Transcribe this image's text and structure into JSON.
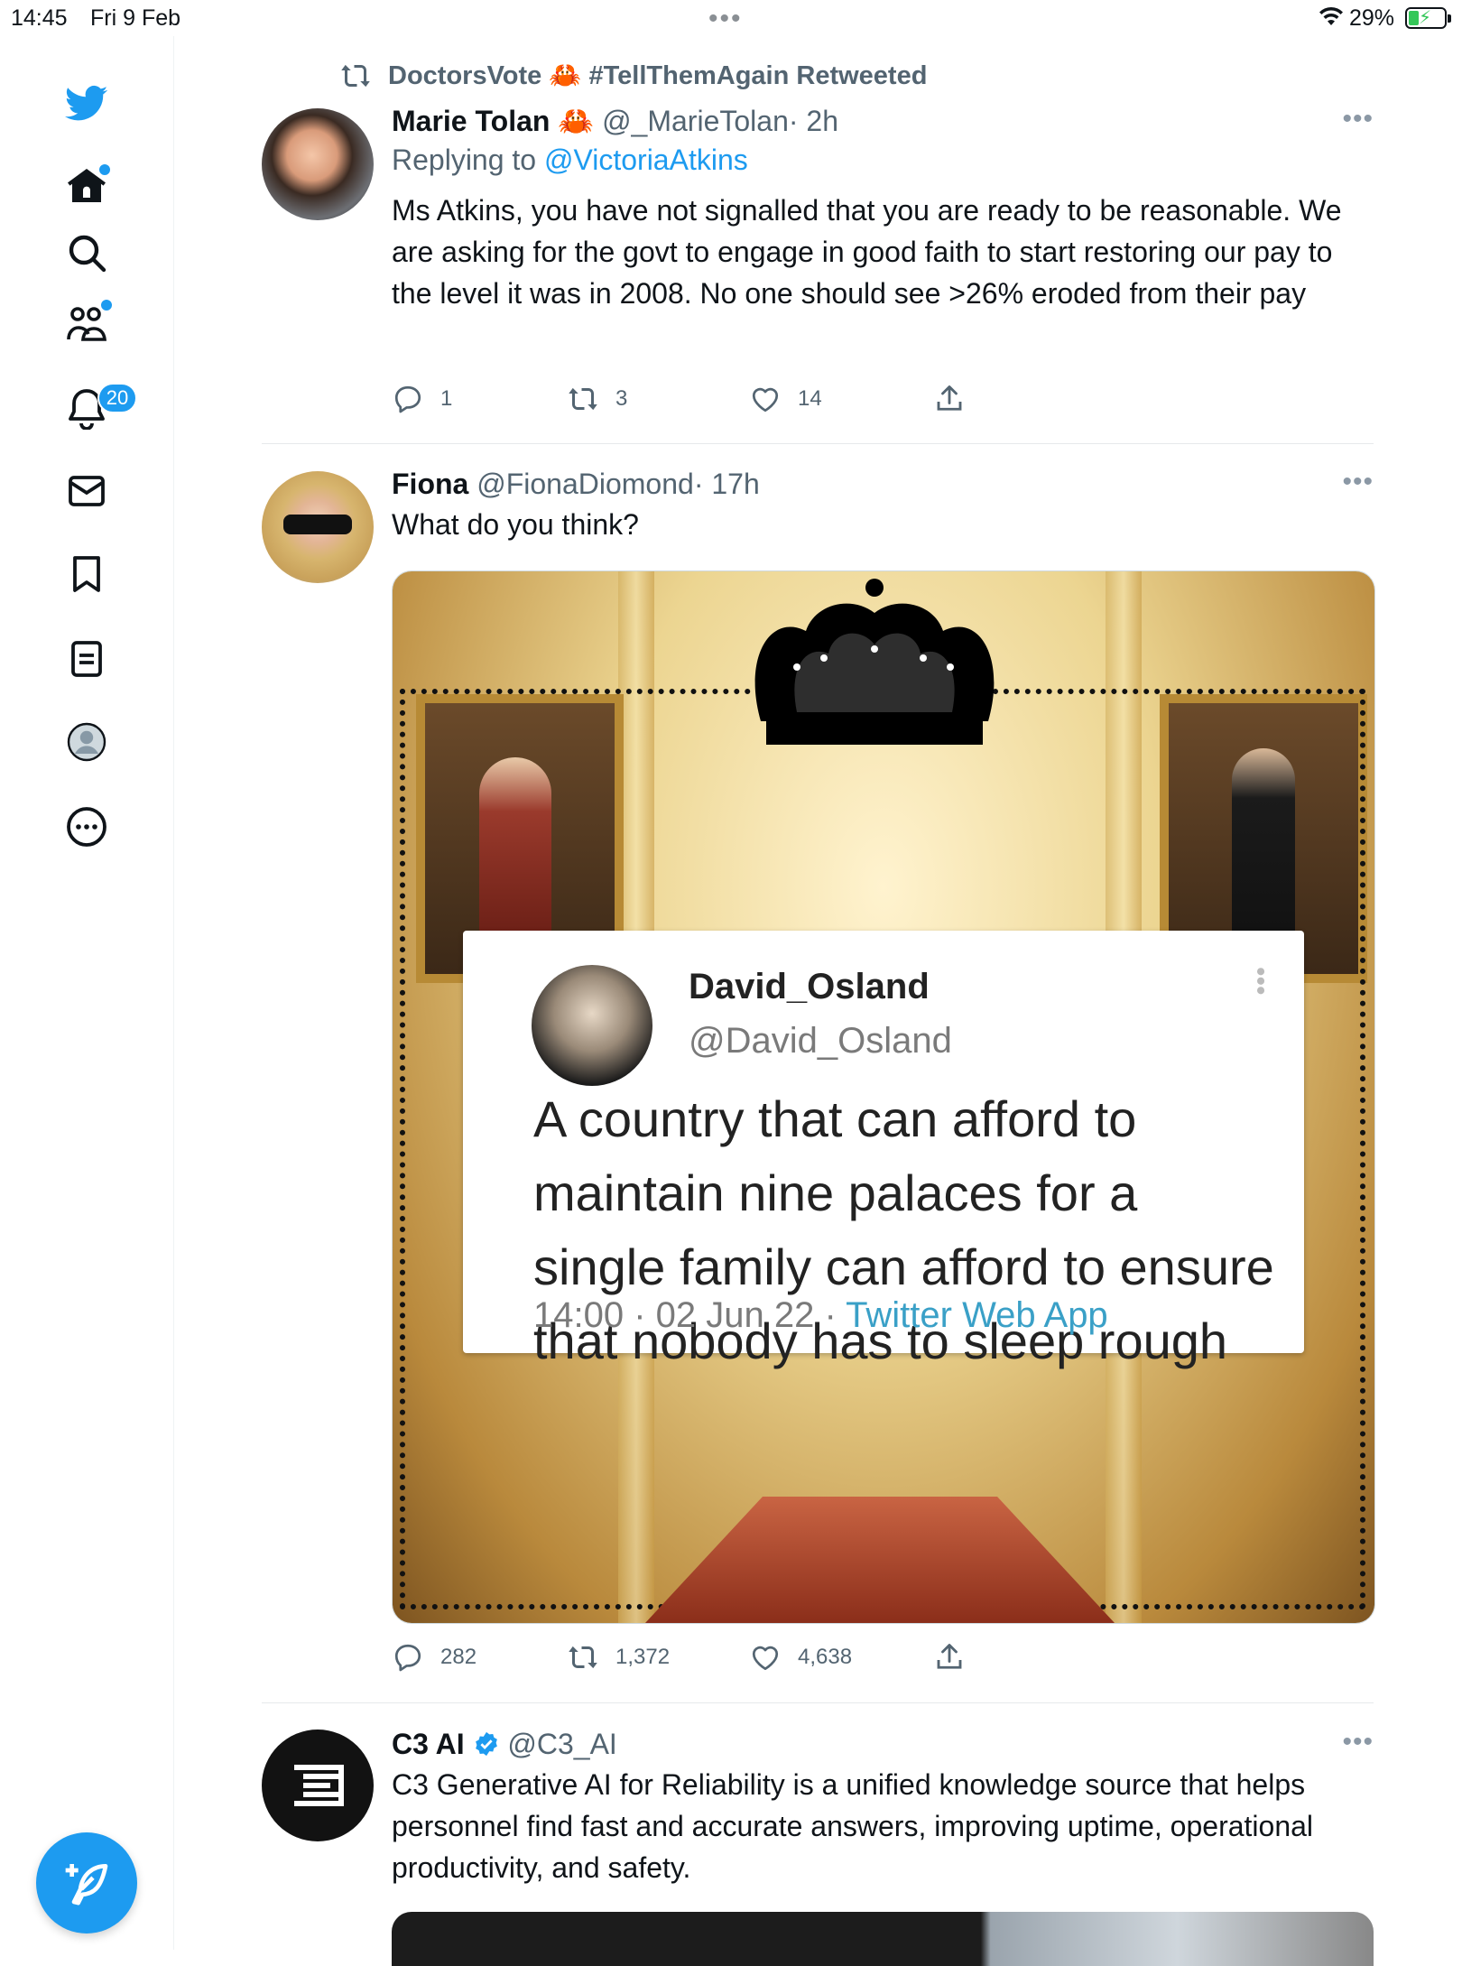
{
  "status_bar": {
    "time": "14:45",
    "date": "Fri 9 Feb",
    "multitask_dots": "•••",
    "battery_percent": "29%",
    "battery_level": 0.29,
    "charging": true
  },
  "sidebar": {
    "items": [
      {
        "name": "twitter-logo",
        "icon": "bird-icon"
      },
      {
        "name": "home",
        "icon": "home-icon",
        "has_dot": true
      },
      {
        "name": "explore",
        "icon": "search-icon"
      },
      {
        "name": "communities",
        "icon": "people-icon",
        "has_dot": true
      },
      {
        "name": "notifications",
        "icon": "bell-icon",
        "badge": "20"
      },
      {
        "name": "messages",
        "icon": "envelope-icon"
      },
      {
        "name": "bookmarks",
        "icon": "bookmark-icon"
      },
      {
        "name": "lists",
        "icon": "list-icon"
      },
      {
        "name": "profile",
        "icon": "profile-icon"
      },
      {
        "name": "more",
        "icon": "more-circle-icon"
      }
    ],
    "compose_icon": "compose-feather-icon"
  },
  "tweets": [
    {
      "retweeted_by": "DoctorsVote 🦀 #TellThemAgain Retweeted",
      "name": "Marie Tolan 🦀",
      "handle": "@_MarieTolan",
      "time": "· 2h",
      "replying_prefix": "Replying to ",
      "replying_to": "@VictoriaAtkins",
      "text": "Ms Atkins, you have not signalled that you are ready to be reasonable. We are asking for the govt to engage in good faith to start restoring our pay to the level it was in 2008. No one should see >26% eroded from their pay",
      "replies": "1",
      "retweets": "3",
      "likes": "14"
    },
    {
      "name": "Fiona",
      "handle": "@FionaDiomond",
      "time": "· 17h",
      "text": "What do you think?",
      "media": {
        "quoted_name": "David_Osland",
        "quoted_handle": "@David_Osland",
        "quoted_text": "A country that can afford to maintain nine palaces for a single family can afford to ensure that nobody has to sleep rough",
        "quoted_time": "14:00 · 02 Jun 22 · ",
        "quoted_app": "Twitter Web App"
      },
      "replies": "282",
      "retweets": "1,372",
      "likes": "4,638"
    },
    {
      "name": "C3 AI",
      "handle": "@C3_AI",
      "verified": true,
      "text": "C3 Generative AI for Reliability is a unified knowledge source that helps personnel find fast and accurate answers, improving uptime, operational productivity, and safety."
    }
  ],
  "more_glyph": "•••",
  "colors": {
    "accent": "#1d9bf0",
    "text": "#0f1419",
    "secondary": "#536471",
    "divider": "#e6e9eb"
  }
}
